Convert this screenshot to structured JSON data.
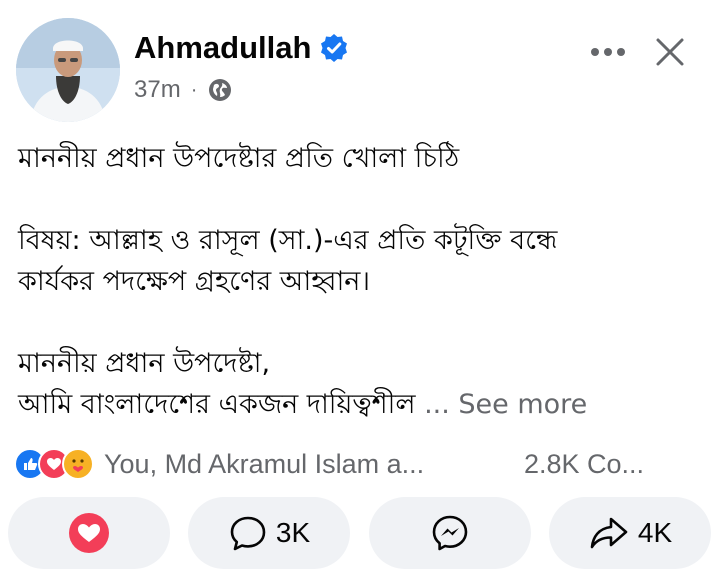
{
  "post": {
    "author": "Ahmadullah",
    "time": "37m",
    "separator": "·",
    "verified_icon": "verified-badge-icon",
    "privacy_icon": "globe-icon",
    "body": {
      "line1": "মাননীয় প্রধান উপদেষ্টার প্রতি খোলা চিঠি",
      "line2": "বিষয়: আল্লাহ ও রাসূল (সা.)-এর প্রতি কটূক্তি বন্ধে",
      "line3": "কার্যকর পদক্ষেপ গ্রহণের আহ্বান।",
      "line4": "মাননীয় প্রধান উপদেষ্টা,",
      "line5": "আমি বাংলাদেশের একজন দায়িত্বশীল",
      "see_more": "... See more"
    }
  },
  "reactions": {
    "icons": [
      "like-icon",
      "love-icon",
      "care-icon"
    ],
    "names": "You, Md Akramul Islam a...",
    "comments": "2.8K Co..."
  },
  "actions": {
    "comment_count": "3K",
    "share_count": "4K"
  },
  "colors": {
    "like_blue": "#1877f2",
    "love_red": "#f33e58",
    "care_yellow": "#f7b125",
    "verified_blue": "#1877f2",
    "secondary_text": "#65676b",
    "button_bg": "#f0f2f5"
  }
}
